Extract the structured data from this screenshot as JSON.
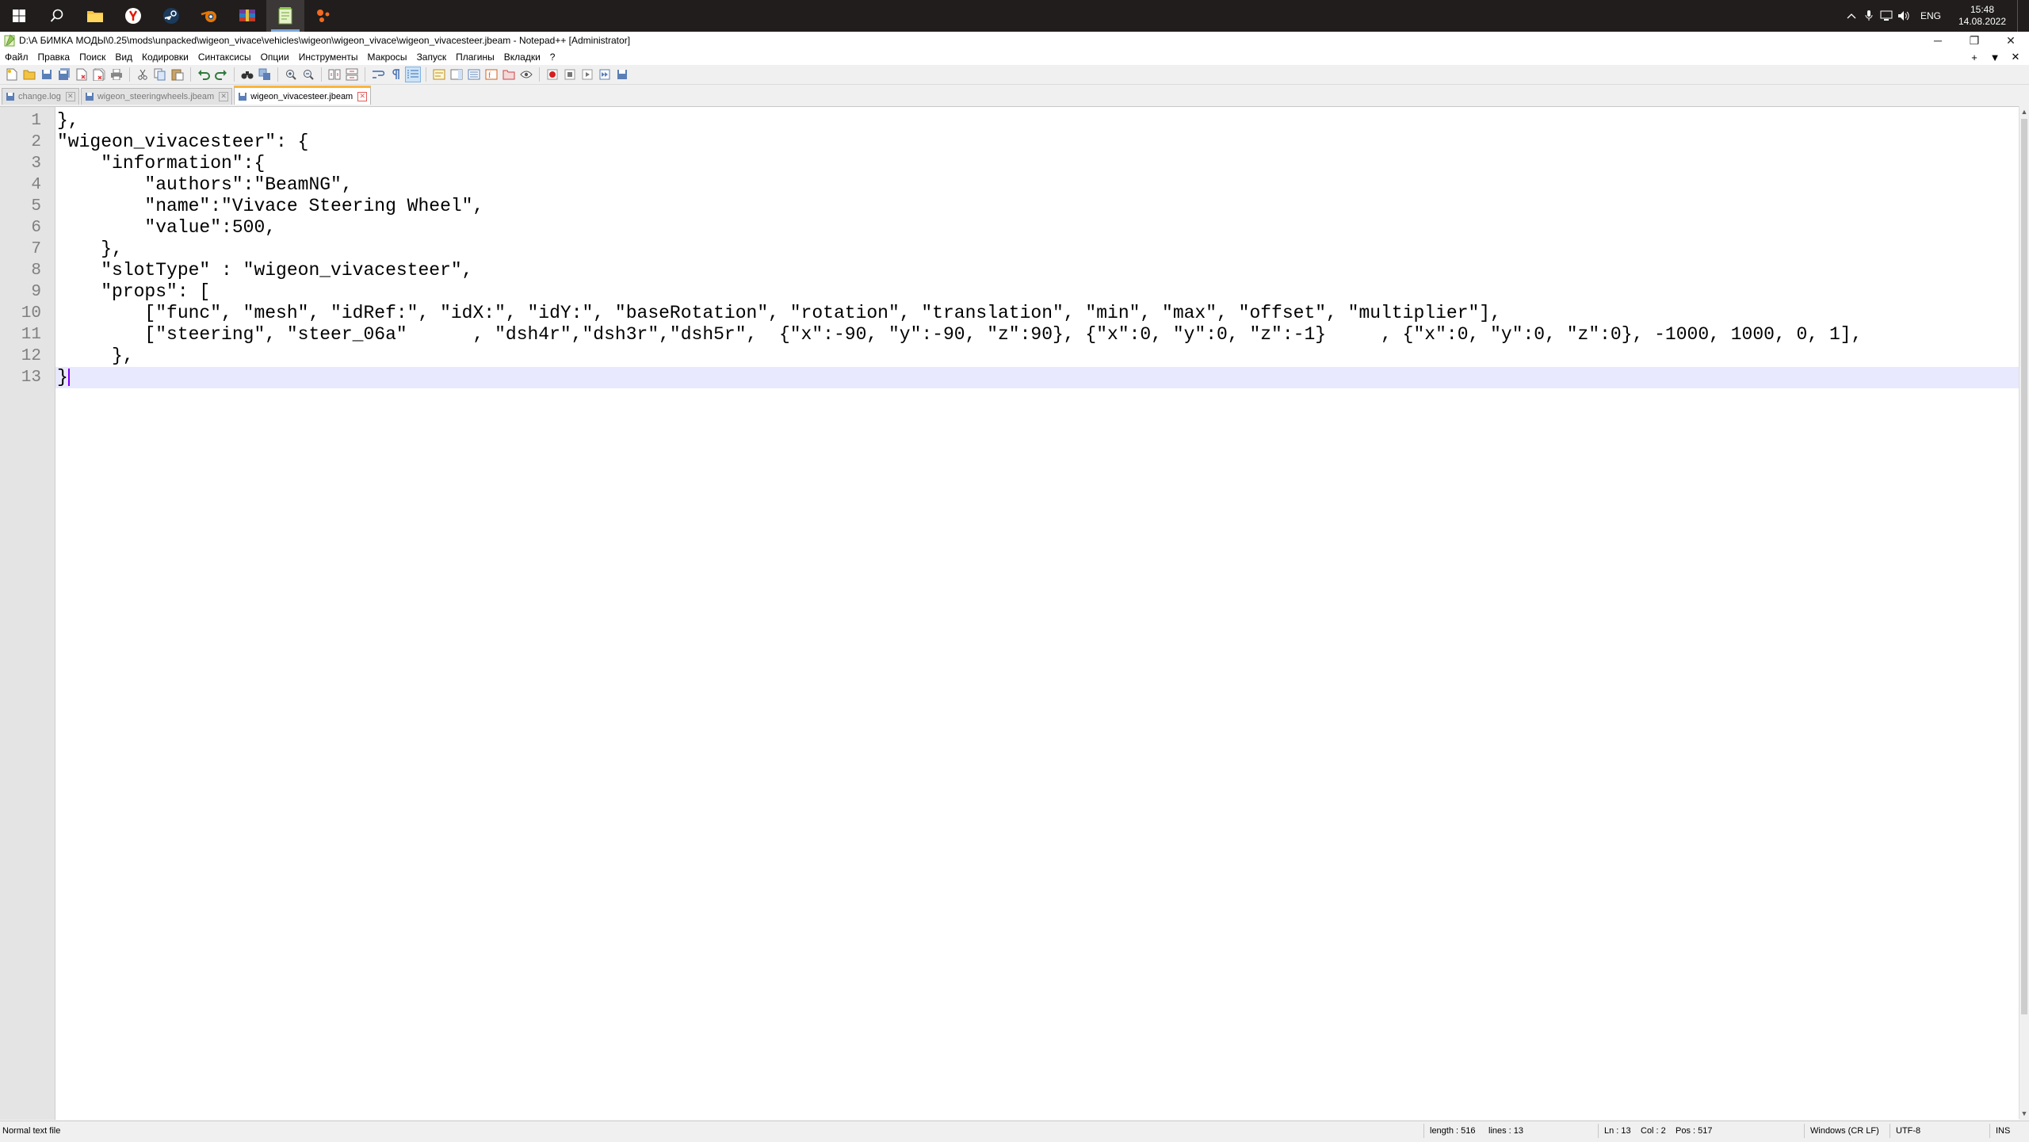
{
  "taskbar": {
    "apps": [
      {
        "name": "start",
        "icon": "windows-logo-icon"
      },
      {
        "name": "search",
        "icon": "search-icon"
      },
      {
        "name": "file-explorer",
        "icon": "folder-icon"
      },
      {
        "name": "yandex-browser",
        "icon": "yandex-icon"
      },
      {
        "name": "steam",
        "icon": "steam-icon"
      },
      {
        "name": "blender",
        "icon": "blender-icon"
      },
      {
        "name": "winrar",
        "icon": "winrar-icon"
      },
      {
        "name": "notepad-plus-plus",
        "icon": "notepad-plus-plus-icon"
      },
      {
        "name": "app",
        "icon": "dots-app-icon"
      }
    ],
    "tray": {
      "language": "ENG",
      "time": "15:48",
      "date": "14.08.2022"
    }
  },
  "window": {
    "title": "D:\\А БИМКА МОДЫ\\0.25\\mods\\unpacked\\wigeon_vivace\\vehicles\\wigeon\\wigeon_vivace\\wigeon_vivacesteer.jbeam - Notepad++ [Administrator]",
    "controls": {
      "minimize": "─",
      "restore": "❐",
      "close": "✕"
    }
  },
  "menu": {
    "items": [
      "Файл",
      "Правка",
      "Поиск",
      "Вид",
      "Кодировки",
      "Синтаксисы",
      "Опции",
      "Инструменты",
      "Макросы",
      "Запуск",
      "Плагины",
      "Вкладки",
      "?"
    ],
    "right": [
      "+",
      "▼",
      "✕"
    ]
  },
  "tabs": [
    {
      "label": "change.log",
      "active": false
    },
    {
      "label": "wigeon_steeringwheels.jbeam",
      "active": false
    },
    {
      "label": "wigeon_vivacesteer.jbeam",
      "active": true
    }
  ],
  "editor": {
    "lines": [
      "},",
      "\"wigeon_vivacesteer\": {",
      "    \"information\":{",
      "        \"authors\":\"BeamNG\",",
      "        \"name\":\"Vivace Steering Wheel\",",
      "        \"value\":500,",
      "    },",
      "    \"slotType\" : \"wigeon_vivacesteer\",",
      "    \"props\": [",
      "        [\"func\", \"mesh\", \"idRef:\", \"idX:\", \"idY:\", \"baseRotation\", \"rotation\", \"translation\", \"min\", \"max\", \"offset\", \"multiplier\"],",
      "        [\"steering\", \"steer_06a\"      , \"dsh4r\",\"dsh3r\",\"dsh5r\",  {\"x\":-90, \"y\":-90, \"z\":90}, {\"x\":0, \"y\":0, \"z\":-1}     , {\"x\":0, \"y\":0, \"z\":0}, -1000, 1000, 0, 1],",
      "     },",
      "}"
    ],
    "current_line": 13
  },
  "status": {
    "file_type": "Normal text file",
    "length": "length : 516",
    "lines": "lines : 13",
    "ln": "Ln : 13",
    "col": "Col : 2",
    "pos": "Pos : 517",
    "eol": "Windows (CR LF)",
    "encoding": "UTF-8",
    "mode": "INS"
  },
  "colors": {
    "taskbar_bg": "#201d1c",
    "current_line_bg": "#e8e8ff",
    "caret": "#8000ff",
    "active_tab_accent": "#fab43c"
  }
}
